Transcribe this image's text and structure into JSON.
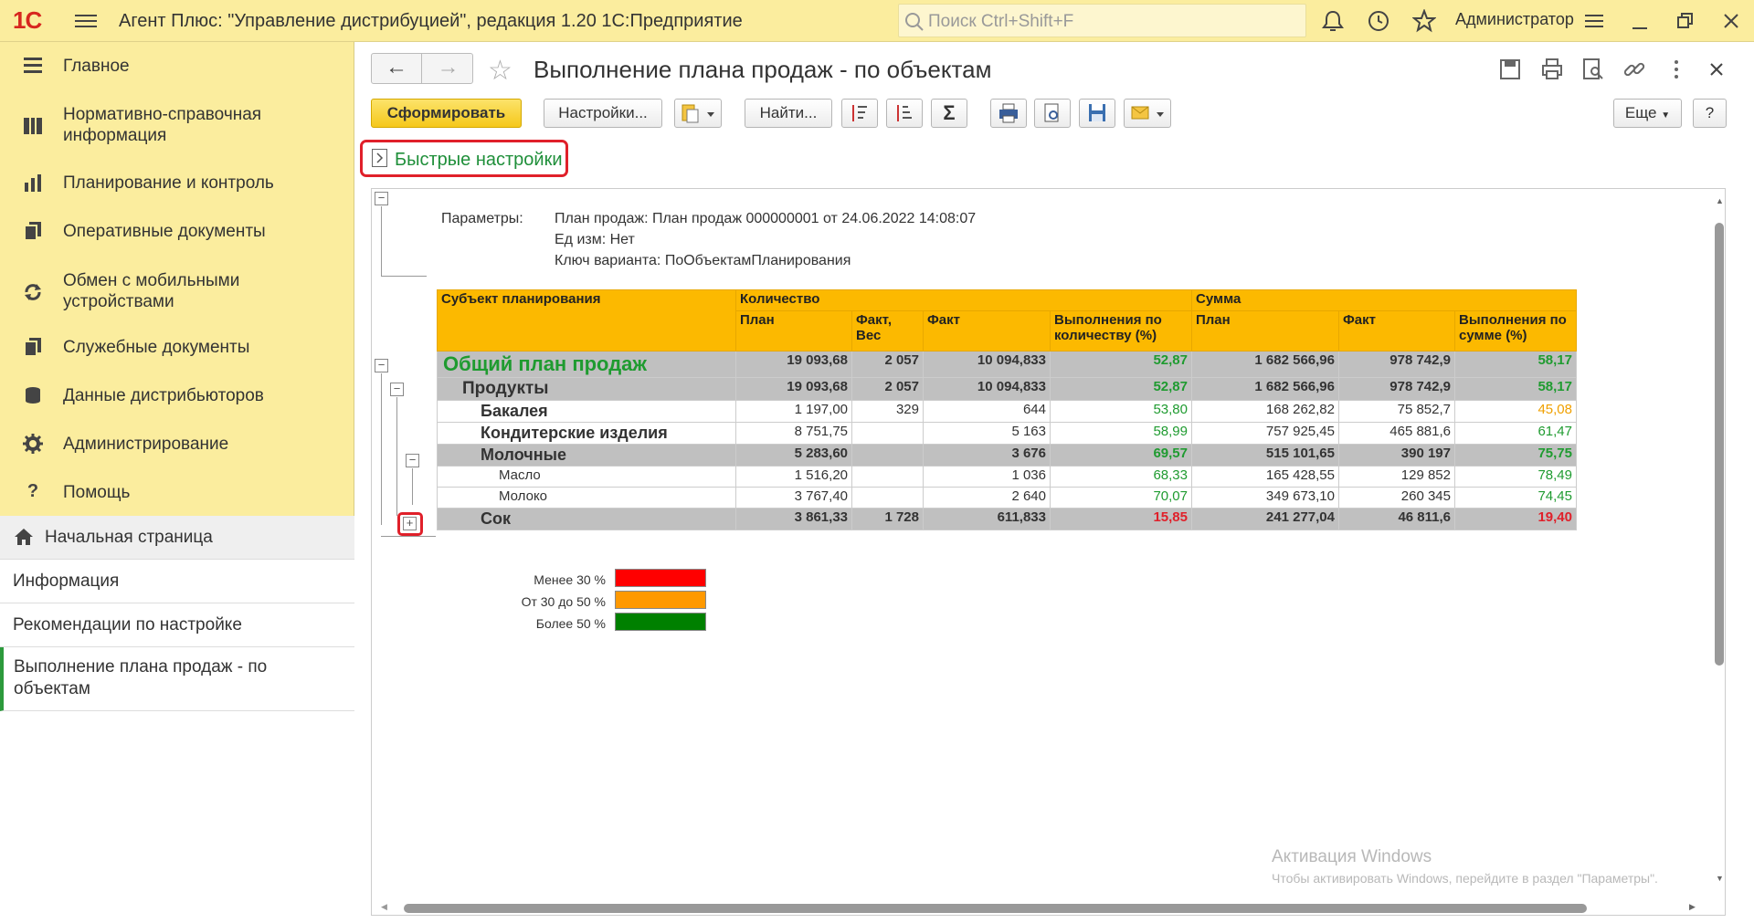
{
  "topbar": {
    "logo": "1С",
    "title": "Агент Плюс: \"Управление дистрибуцией\", редакция 1.20 1С:Предприятие",
    "search_placeholder": "Поиск Ctrl+Shift+F",
    "user": "Администратор"
  },
  "sidebar": {
    "items": [
      {
        "label": "Главное",
        "icon": "menu-lines-icon"
      },
      {
        "label": "Нормативно-справочная информация",
        "icon": "grid-icon"
      },
      {
        "label": "Планирование и контроль",
        "icon": "bar-chart-icon"
      },
      {
        "label": "Оперативные документы",
        "icon": "documents-icon"
      },
      {
        "label": "Обмен с мобильными устройствами",
        "icon": "sync-icon"
      },
      {
        "label": "Служебные документы",
        "icon": "documents-icon"
      },
      {
        "label": "Данные дистрибьюторов",
        "icon": "database-icon"
      },
      {
        "label": "Администрирование",
        "icon": "gear-icon"
      },
      {
        "label": "Помощь",
        "icon": "question-icon"
      }
    ]
  },
  "nav": {
    "items": [
      "Начальная страница",
      "Информация",
      "Рекомендации по настройке",
      "Выполнение плана продаж - по объектам"
    ]
  },
  "doc": {
    "title": "Выполнение плана продаж - по объектам"
  },
  "toolbar": {
    "generate": "Сформировать",
    "settings": "Настройки...",
    "find": "Найти...",
    "more": "Еще",
    "help": "?"
  },
  "quick_settings": "Быстрые настройки",
  "params": {
    "label": "Параметры:",
    "lines": [
      "План продаж: План продаж 000000001 от 24.06.2022 14:08:07",
      "Ед изм: Нет",
      "Ключ варианта: ПоОбъектамПланирования"
    ]
  },
  "table": {
    "h_subject": "Субъект планирования",
    "h_qty": "Количество",
    "h_sum": "Сумма",
    "h_plan": "План",
    "h_factw": "Факт, Вес",
    "h_fact": "Факт",
    "h_execq": "Выполнения по количеству (%)",
    "h_plan2": "План",
    "h_fact2": "Факт",
    "h_execs": "Выполнения по сумме (%)",
    "rows": [
      {
        "name": "Общий план продаж",
        "plan": "19 093,68",
        "factw": "2 057",
        "fact": "10 094,833",
        "execq": "52,87",
        "plan2": "1 682 566,96",
        "fact2": "978 742,9",
        "execs": "58,17"
      },
      {
        "name": "Продукты",
        "plan": "19 093,68",
        "factw": "2 057",
        "fact": "10 094,833",
        "execq": "52,87",
        "plan2": "1 682 566,96",
        "fact2": "978 742,9",
        "execs": "58,17"
      },
      {
        "name": "Бакалея",
        "plan": "1 197,00",
        "factw": "329",
        "fact": "644",
        "execq": "53,80",
        "plan2": "168 262,82",
        "fact2": "75 852,7",
        "execs": "45,08"
      },
      {
        "name": "Кондитерские изделия",
        "plan": "8 751,75",
        "factw": "",
        "fact": "5 163",
        "execq": "58,99",
        "plan2": "757 925,45",
        "fact2": "465 881,6",
        "execs": "61,47"
      },
      {
        "name": "Молочные",
        "plan": "5 283,60",
        "factw": "",
        "fact": "3 676",
        "execq": "69,57",
        "plan2": "515 101,65",
        "fact2": "390 197",
        "execs": "75,75"
      },
      {
        "name": "Масло",
        "plan": "1 516,20",
        "factw": "",
        "fact": "1 036",
        "execq": "68,33",
        "plan2": "165 428,55",
        "fact2": "129 852",
        "execs": "78,49"
      },
      {
        "name": "Молоко",
        "plan": "3 767,40",
        "factw": "",
        "fact": "2 640",
        "execq": "70,07",
        "plan2": "349 673,10",
        "fact2": "260 345",
        "execs": "74,45"
      },
      {
        "name": "Сок",
        "plan": "3 861,33",
        "factw": "1 728",
        "fact": "611,833",
        "execq": "15,85",
        "plan2": "241 277,04",
        "fact2": "46 811,6",
        "execs": "19,40"
      }
    ]
  },
  "legend": [
    {
      "label": "Менее 30 %",
      "color": "#ff0000"
    },
    {
      "label": "От 30 до 50 %",
      "color": "#ff9900"
    },
    {
      "label": "Более 50 %",
      "color": "#008000"
    }
  ],
  "watermark": {
    "title": "Активация Windows",
    "text": "Чтобы активировать Windows, перейдите в раздел \"Параметры\"."
  },
  "colors": {
    "green": "#1f9b30",
    "orange": "#f0a000",
    "red": "#e0202a",
    "header": "#fcb900",
    "topbar": "#fbed9e"
  }
}
